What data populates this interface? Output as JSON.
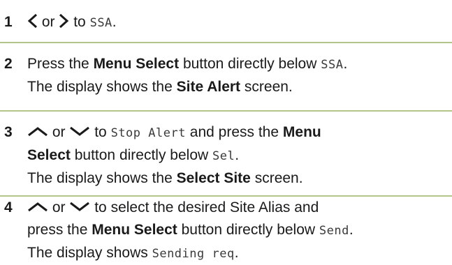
{
  "steps": [
    {
      "number": "1",
      "parts": {
        "or": "or",
        "to": "to",
        "lcd_target": "SSA",
        "end": "."
      }
    },
    {
      "number": "2",
      "parts": {
        "press": "Press the",
        "menu_select": "Menu Select",
        "button_below": "button directly below",
        "lcd_target": "SSA",
        "end": ".",
        "display_shows": "The display shows the",
        "screen_name": "Site Alert",
        "screen_word": "screen."
      }
    },
    {
      "number": "3",
      "parts": {
        "or": "or",
        "to": "to",
        "lcd_target": "Stop Alert",
        "and_press": "and press the",
        "menu": "Menu",
        "select": "Select",
        "button_below": "button directly below",
        "lcd_sel": "Sel",
        "end": ".",
        "display_shows": "The display shows the",
        "screen_name": "Select Site",
        "screen_word": "screen."
      }
    },
    {
      "number": "4",
      "parts": {
        "or": "or",
        "to_select": "to select the desired Site Alias and",
        "press": "press the",
        "menu_select": "Menu Select",
        "button_below": "button directly below",
        "lcd_send": "Send",
        "end": ".",
        "display_shows": "The display shows",
        "lcd_sending": "Sending req",
        "end2": "."
      }
    }
  ],
  "icons": {
    "left": "chevron-left-icon",
    "right": "chevron-right-icon",
    "up": "chevron-up-icon",
    "down": "chevron-down-icon"
  },
  "colors": {
    "divider": "#b5c48a",
    "text": "#1a1a1a"
  }
}
